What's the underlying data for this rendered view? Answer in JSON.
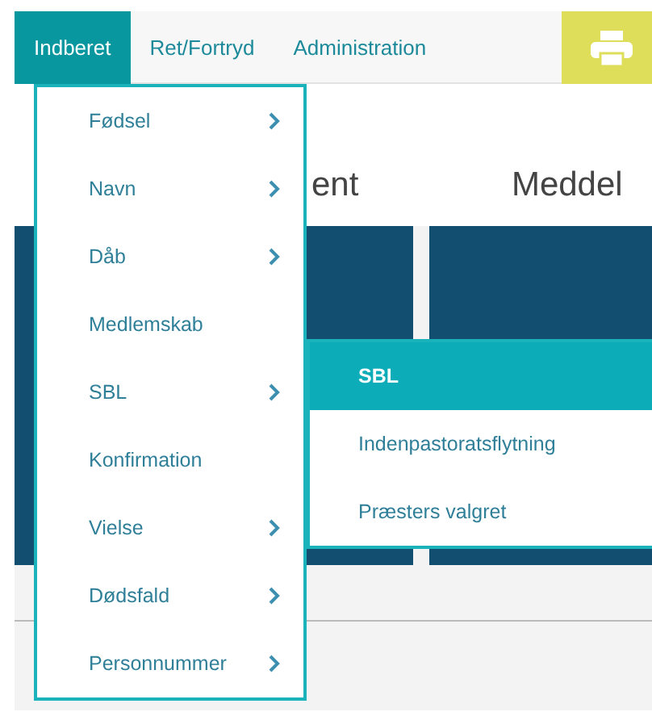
{
  "nav": {
    "tabs": [
      {
        "label": "Indberet",
        "selected": true
      },
      {
        "label": "Ret/Fortryd",
        "selected": false
      },
      {
        "label": "Administration",
        "selected": false
      }
    ]
  },
  "cards": [
    {
      "heading": "ent"
    },
    {
      "heading": "Meddel"
    }
  ],
  "menu": {
    "items": [
      {
        "label": "Fødsel",
        "has_submenu": true
      },
      {
        "label": "Navn",
        "has_submenu": true
      },
      {
        "label": "Dåb",
        "has_submenu": true
      },
      {
        "label": "Medlemskab",
        "has_submenu": false
      },
      {
        "label": "SBL",
        "has_submenu": true,
        "submenu": [
          {
            "label": "SBL",
            "selected": true
          },
          {
            "label": "Indenpastoratsflytning",
            "selected": false
          },
          {
            "label": "Præsters valgret",
            "selected": false
          }
        ]
      },
      {
        "label": "Konfirmation",
        "has_submenu": false
      },
      {
        "label": "Vielse",
        "has_submenu": true
      },
      {
        "label": "Dødsfald",
        "has_submenu": true
      },
      {
        "label": "Personnummer",
        "has_submenu": true
      }
    ]
  }
}
